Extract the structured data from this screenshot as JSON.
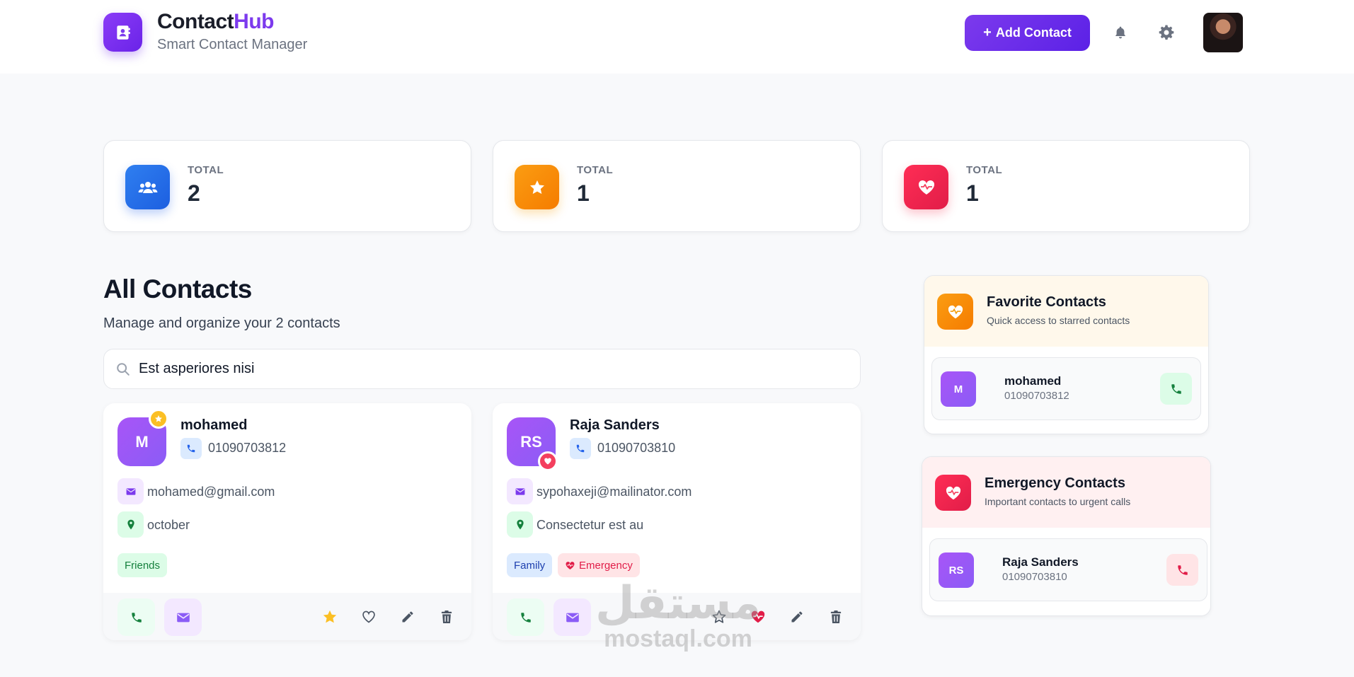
{
  "header": {
    "brand_main": "Contact",
    "brand_accent": "Hub",
    "tagline": "Smart Contact Manager",
    "add_button": "Add Contact",
    "colors": {
      "accent": "#7c3aed"
    }
  },
  "stats": [
    {
      "label": "TOTAL",
      "value": "2",
      "icon": "users-icon",
      "color": "#2563eb"
    },
    {
      "label": "TOTAL",
      "value": "1",
      "icon": "star-icon",
      "color": "#f59e0b"
    },
    {
      "label": "TOTAL",
      "value": "1",
      "icon": "heart-pulse-icon",
      "color": "#f43f5e"
    }
  ],
  "section": {
    "title": "All Contacts",
    "subtitle": "Manage and organize your 2 contacts"
  },
  "search": {
    "value": "Est asperiores nisi"
  },
  "contacts": [
    {
      "initials": "M",
      "name": "mohamed",
      "phone": "01090703812",
      "email": "mohamed@gmail.com",
      "address": "october",
      "tags": [
        "Friends"
      ],
      "favorite": true,
      "emergency": false
    },
    {
      "initials": "RS",
      "name": "Raja Sanders",
      "phone": "01090703810",
      "email": "sypohaxeji@mailinator.com",
      "address": "Consectetur est au",
      "tags": [
        "Family",
        "Emergency"
      ],
      "favorite": false,
      "emergency": true
    }
  ],
  "favorites_panel": {
    "title": "Favorite Contacts",
    "subtitle": "Quick access to starred contacts",
    "items": [
      {
        "initials": "M",
        "name": "mohamed",
        "phone": "01090703812"
      }
    ]
  },
  "emergency_panel": {
    "title": "Emergency Contacts",
    "subtitle": "Important contacts to urgent calls",
    "items": [
      {
        "initials": "RS",
        "name": "Raja Sanders",
        "phone": "01090703810"
      }
    ]
  },
  "watermark": {
    "arabic": "مستقل",
    "latin": "mostaql.com"
  }
}
